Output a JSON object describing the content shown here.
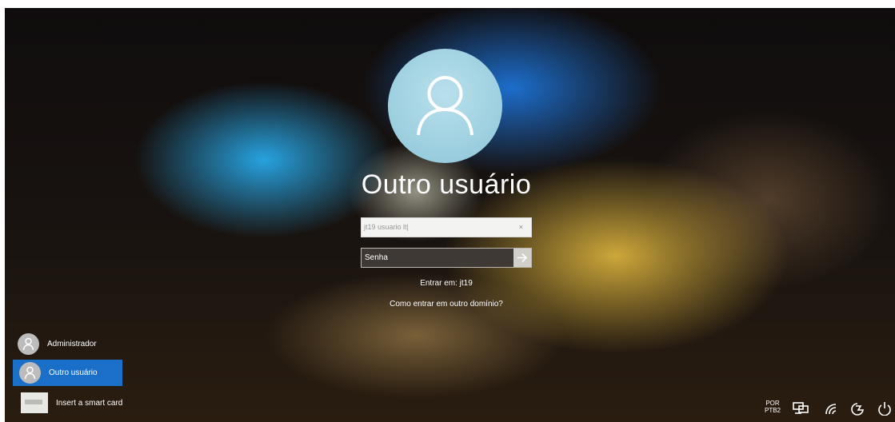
{
  "selected_user": {
    "name": "Outro usuário",
    "icon": "user-icon"
  },
  "login": {
    "username_value": "jt19 usuario lt|",
    "password_placeholder": "Senha",
    "sign_in_to": "Entrar em: jt19",
    "other_domain_link": "Como entrar em outro domínio?"
  },
  "accounts": [
    {
      "label": "Administrador",
      "icon": "user-icon",
      "selected": false
    },
    {
      "label": "Outro usuário",
      "icon": "user-icon",
      "selected": true
    },
    {
      "label": "Insert a smart card",
      "icon": "smart-card-icon",
      "selected": false
    }
  ],
  "tray": {
    "language_line1": "POR",
    "language_line2": "PTB2",
    "icons": [
      "network-icon",
      "wifi-icon",
      "accessibility-icon",
      "power-icon"
    ]
  },
  "colors": {
    "selected_account": "#1a6fc8",
    "avatar": "#a5d4e3"
  }
}
